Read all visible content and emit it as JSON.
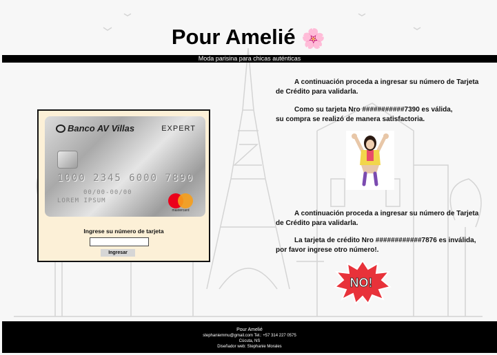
{
  "header": {
    "title": "Pour Amelié",
    "flower": "🌸",
    "tagline": "Moda parisina para chicas auténticas"
  },
  "card": {
    "bank": "Banco AV Villas",
    "brand_tier": "EXPERT",
    "number": "1000 2345 6000 7890",
    "dates": "00/00-00/00",
    "holder": "LOREM IPSUM",
    "network": "mastercard"
  },
  "form": {
    "label": "Ingrese su número de tarjeta",
    "input_value": "",
    "submit_label": "Ingresar"
  },
  "messages": {
    "valid": {
      "intro": "A continuación proceda a ingresar su número de Tarjeta de Crédito para validarla.",
      "result": "Como su tarjeta Nro ###########7390 es válida, su compra se realizó de manera satisfactoria."
    },
    "invalid": {
      "intro": "A continuación proceda a ingresar su número de Tarjeta de Crédito para validarla.",
      "result": "La tarjeta de crédito Nro ############7876 es inválida, por favor ingrese otro número!."
    },
    "no_sticker_text": "NO!"
  },
  "footer": {
    "title": "Pour Amelié",
    "contact": "stephaniemmu@gmail.com Tel.: +57 314 227 0575",
    "location": "Cúcuta, NS",
    "designer": "Diseñador web: Stephanie Morales"
  },
  "colors": {
    "panel_bg": "#fcf0d7",
    "bar_bg": "#000000",
    "no_red": "#e8323a"
  }
}
